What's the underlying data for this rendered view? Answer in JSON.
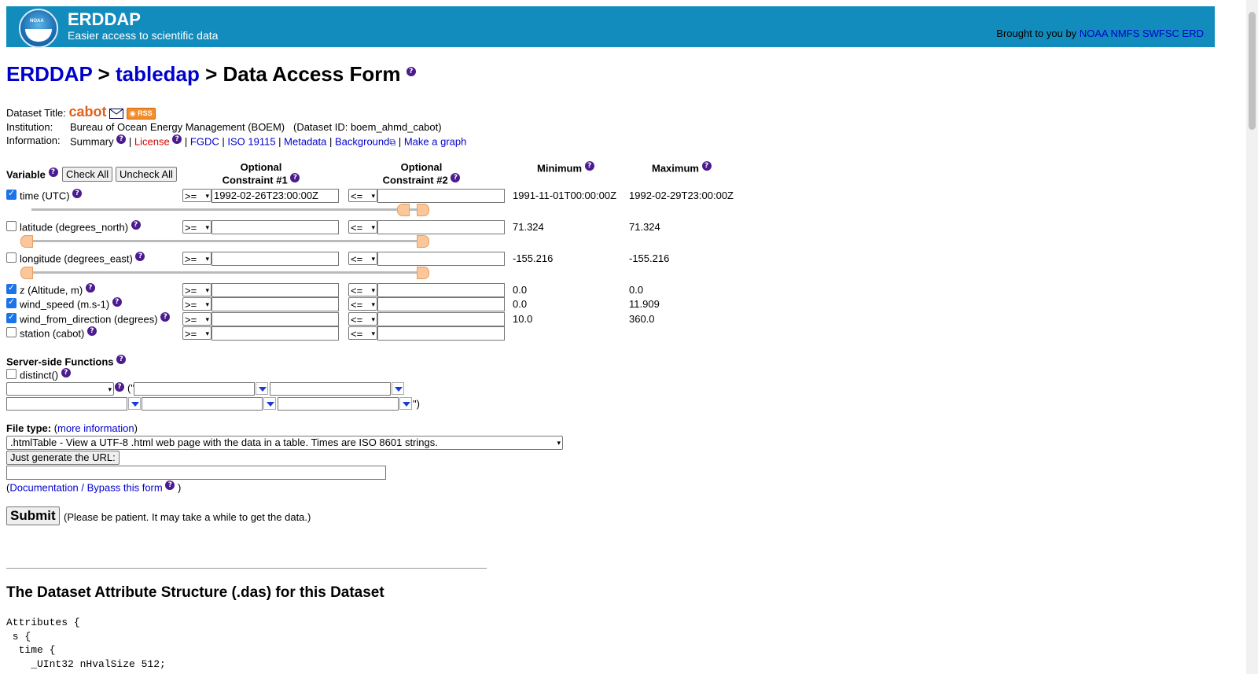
{
  "header": {
    "app_name": "ERDDAP",
    "tagline": "Easier access to scientific data",
    "brought_prefix": "Brought to you by",
    "brought_link": "NOAA NMFS SWFSC ERD",
    "logo_text": "NOAA"
  },
  "breadcrumb": {
    "root": "ERDDAP",
    "sep1": " > ",
    "section": "tabledap",
    "sep2": " > ",
    "page": "Data Access Form"
  },
  "dataset": {
    "title_label": "Dataset Title:",
    "title": "cabot",
    "rss_label": "RSS",
    "institution_label": "Institution:",
    "institution": "Bureau of Ocean Energy Management (BOEM)",
    "dataset_id": "(Dataset ID: boem_ahmd_cabot)",
    "information_label": "Information:",
    "links": {
      "summary": "Summary",
      "license": "License",
      "fgdc": "FGDC",
      "iso": "ISO 19115",
      "metadata": "Metadata",
      "background": "Background",
      "graph": "Make a graph"
    }
  },
  "table": {
    "variable_header": "Variable",
    "check_all": "Check All",
    "uncheck_all": "Uncheck All",
    "optional": "Optional",
    "constraint1": "Constraint #1",
    "constraint2": "Constraint #2",
    "minimum": "Minimum",
    "maximum": "Maximum",
    "rows": [
      {
        "label": "time (UTC)",
        "checked": true,
        "op1": ">=",
        "val1": "1992-02-26T23:00:00Z",
        "op2": "<=",
        "val2": "",
        "min": "1991-11-01T00:00:00Z",
        "max": "1992-02-29T23:00:00Z"
      },
      {
        "label": "latitude (degrees_north)",
        "checked": false,
        "op1": ">=",
        "val1": "",
        "op2": "<=",
        "val2": "",
        "min": "71.324",
        "max": "71.324"
      },
      {
        "label": "longitude (degrees_east)",
        "checked": false,
        "op1": ">=",
        "val1": "",
        "op2": "<=",
        "val2": "",
        "min": "-155.216",
        "max": "-155.216"
      },
      {
        "label": "z (Altitude, m)",
        "checked": true,
        "op1": ">=",
        "val1": "",
        "op2": "<=",
        "val2": "",
        "min": "0.0",
        "max": "0.0"
      },
      {
        "label": "wind_speed (m.s-1)",
        "checked": true,
        "op1": ">=",
        "val1": "",
        "op2": "<=",
        "val2": "",
        "min": "0.0",
        "max": "11.909"
      },
      {
        "label": "wind_from_direction (degrees)",
        "checked": true,
        "op1": ">=",
        "val1": "",
        "op2": "<=",
        "val2": "",
        "min": "10.0",
        "max": "360.0"
      },
      {
        "label": "station (cabot)",
        "checked": false,
        "op1": ">=",
        "val1": "",
        "op2": "<=",
        "val2": "",
        "min": "",
        "max": ""
      }
    ]
  },
  "server_functions": {
    "title": "Server-side Functions",
    "distinct": "distinct()",
    "open_paren": "(\"",
    "close_paren": "\")"
  },
  "file_type": {
    "label": "File type:",
    "more_info_open": "(",
    "more_info": "more information",
    "more_info_close": ")",
    "selected": ".htmlTable - View a UTF-8 .html web page with the data in a table. Times are ISO 8601 strings.",
    "generate_url": "Just generate the URL:",
    "url_value": "",
    "doc_open": "(",
    "doc_link": "Documentation / Bypass this form",
    "doc_close": " )"
  },
  "submit": {
    "label": "Submit",
    "note": "(Please be patient. It may take a while to get the data.)"
  },
  "das": {
    "title": "The Dataset Attribute Structure (.das) for this Dataset",
    "lines": "Attributes {\n s {\n  time {\n    _UInt32 nHvalSize 512;"
  }
}
